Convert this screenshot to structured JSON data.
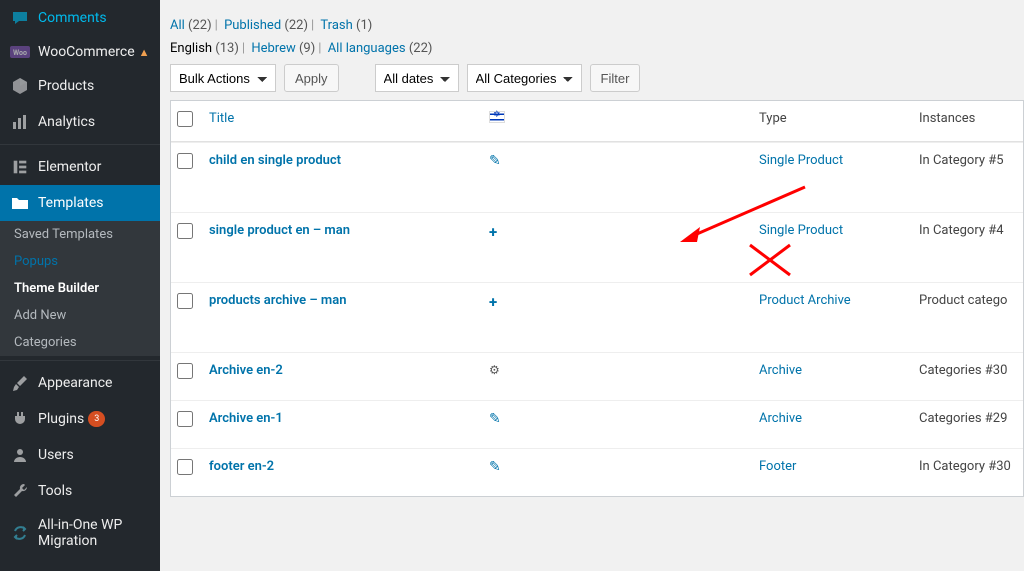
{
  "sidebar": {
    "items": [
      {
        "label": "Comments",
        "icon": "comment"
      },
      {
        "label": "WooCommerce",
        "icon": "woo",
        "warn": true
      },
      {
        "label": "Products",
        "icon": "box"
      },
      {
        "label": "Analytics",
        "icon": "chart"
      },
      {
        "label": "Elementor",
        "icon": "elementor"
      },
      {
        "label": "Templates",
        "icon": "folder",
        "active": true
      },
      {
        "label": "Appearance",
        "icon": "brush"
      },
      {
        "label": "Plugins",
        "icon": "plug",
        "badge": "3"
      },
      {
        "label": "Users",
        "icon": "user"
      },
      {
        "label": "Tools",
        "icon": "wrench"
      },
      {
        "label": "All-in-One WP Migration",
        "icon": "cycle"
      }
    ],
    "submenu": [
      {
        "label": "Saved Templates"
      },
      {
        "label": "Popups",
        "highlight": true
      },
      {
        "label": "Theme Builder",
        "current": true
      },
      {
        "label": "Add New"
      },
      {
        "label": "Categories"
      }
    ]
  },
  "filters": {
    "status": [
      {
        "label": "All",
        "count": "(22)",
        "current": true
      },
      {
        "label": "Published",
        "count": "(22)"
      },
      {
        "label": "Trash",
        "count": "(1)"
      }
    ],
    "lang": [
      {
        "label": "English",
        "count": "(13)",
        "current": true
      },
      {
        "label": "Hebrew",
        "count": "(9)"
      },
      {
        "label": "All languages",
        "count": "(22)"
      }
    ]
  },
  "tablenav": {
    "bulk_actions": "Bulk Actions",
    "apply": "Apply",
    "all_dates": "All dates",
    "all_categories": "All Categories",
    "filter": "Filter"
  },
  "columns": {
    "title": "Title",
    "type": "Type",
    "instances": "Instances"
  },
  "rows": [
    {
      "title": "child en single product",
      "lang_icon": "pencil",
      "type": "Single Product",
      "instances": "In Category #5"
    },
    {
      "title": "single product en – man",
      "lang_icon": "plus",
      "type": "Single Product",
      "instances": "In Category #4"
    },
    {
      "title": "products archive – man",
      "lang_icon": "plus",
      "type": "Product Archive",
      "instances": "Product catego"
    },
    {
      "title": "Archive en-2",
      "lang_icon": "gear",
      "type": "Archive",
      "instances": "Categories #30"
    },
    {
      "title": "Archive en-1",
      "lang_icon": "pencil",
      "type": "Archive",
      "instances": "Categories #29"
    },
    {
      "title": "footer en-2",
      "lang_icon": "pencil",
      "type": "Footer",
      "instances": "In Category #30"
    }
  ]
}
